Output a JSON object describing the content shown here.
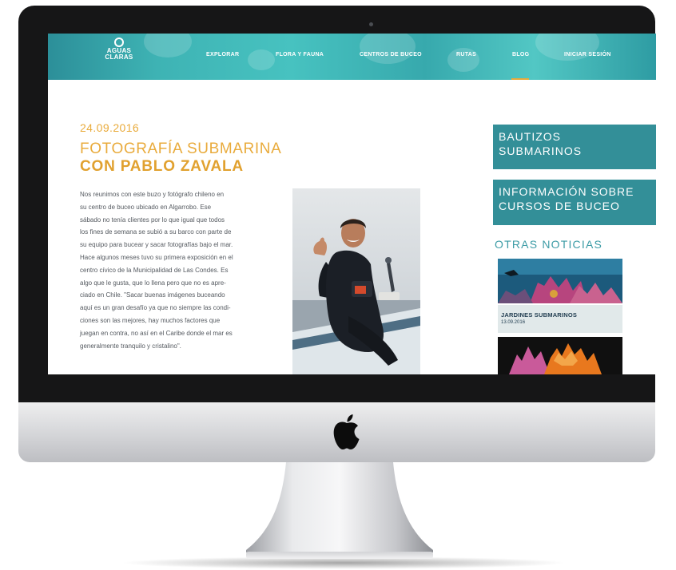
{
  "nav": {
    "logo_line1": "AGUAS",
    "logo_line2": "CLARAS",
    "links": [
      "EXPLORAR",
      "FLORA Y FAUNA",
      "CENTROS DE BUCEO",
      "RUTAS",
      "BLOG",
      "INICIAR SESIÓN"
    ],
    "active": "BLOG"
  },
  "article": {
    "date": "24.09.2016",
    "title_line1": "FOTOGRAFÍA SUBMARINA",
    "title_line2": "CON PABLO ZAVALA",
    "body_lines": [
      "Nos reunimos con este buzo y fotógrafo chileno en",
      "su centro de buceo ubicado en Algarrobo. Ese",
      "sábado no tenía clientes por lo que igual que todos",
      "los fines de semana se subió a su barco con parte de",
      "su equipo para bucear y sacar fotografías bajo el mar.",
      "Hace algunos meses tuvo su primera exposición en el",
      "centro cívico de la Municipalidad de Las Condes. Es",
      "algo que le gusta, que lo llena pero que no es apre-",
      "ciado en Chile. \"Sacar buenas imágenes buceando",
      "aquí es un gran desafío ya que no siempre las condi-",
      "ciones son las mejores, hay muchos factores que",
      "juegan en contra, no así en el Caribe donde el mar es",
      "generalmente tranquilo y cristalino\"."
    ]
  },
  "sidebar": {
    "box1_line1": "BAUTIZOS",
    "box1_line2": "SUBMARINOS",
    "box2_line1": "INFORMACIÓN SOBRE",
    "box2_line2": "CURSOS DE BUCEO",
    "otras_title": "OTRAS NOTICIAS",
    "news": [
      {
        "title": "JARDINES SUBMARINOS",
        "date": "13.09.2016"
      }
    ]
  },
  "colors": {
    "accent_orange": "#e9ab3c",
    "teal": "#338f98",
    "nav_teal": "#3eb3b4"
  }
}
